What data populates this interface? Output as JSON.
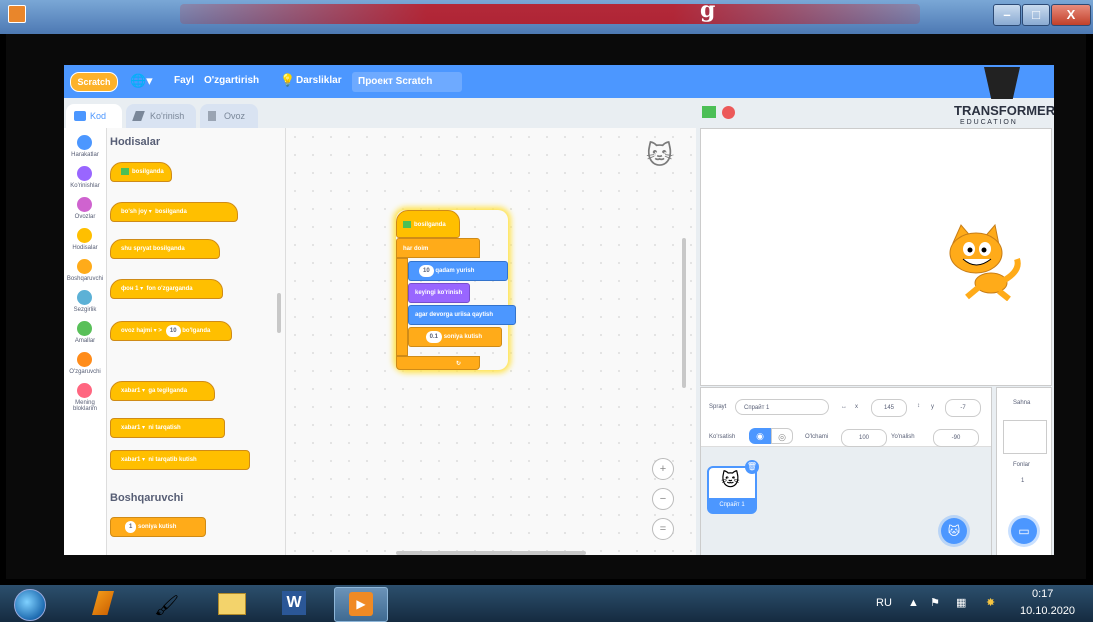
{
  "window": {
    "title_fragment": "g",
    "buttons": {
      "minimize": "–",
      "maximize": "□",
      "close": "X"
    }
  },
  "menubar": {
    "logo": "Scratch",
    "language_icon": "globe-icon",
    "file": "Fayl",
    "edit": "O'zgartirish",
    "tutorials": "Darsliklar",
    "project_title": "Проект Scratch"
  },
  "tabs": [
    {
      "label": "Kod",
      "active": true
    },
    {
      "label": "Ko'rinish",
      "active": false
    },
    {
      "label": "Ovoz",
      "active": false
    }
  ],
  "categories": [
    {
      "label": "Harakatlar",
      "color": "#4c97ff"
    },
    {
      "label": "Ko'rinishlar",
      "color": "#9966ff"
    },
    {
      "label": "Ovozlar",
      "color": "#cf63cf"
    },
    {
      "label": "Hodisalar",
      "color": "#ffbf00"
    },
    {
      "label": "Boshqaruvchi",
      "color": "#ffab19"
    },
    {
      "label": "Sezgirlik",
      "color": "#5cb1d6"
    },
    {
      "label": "Amallar",
      "color": "#59c059"
    },
    {
      "label": "O'zgaruvchi",
      "color": "#ff8c1a"
    },
    {
      "label": "Mening bloklarim",
      "color": "#ff6680"
    }
  ],
  "palette": {
    "section1": "Hodisalar",
    "section2": "Boshqaruvchi",
    "blocks": {
      "b1": "bosilganda",
      "b2_key": "bo'sh joy",
      "b2": "bosilganda",
      "b3": "shu spryat bosilganda",
      "b4_drop": "фон 1",
      "b4": "fon o'zgarganda",
      "b5_drop": "ovoz hajmi",
      "b5_val": "10",
      "b5": "bo'lganda",
      "b6_drop": "xabar1",
      "b6": "ga tegilganda",
      "b7_drop": "xabar1",
      "b7": "ni tarqatish",
      "b8_drop": "xabar1",
      "b8": "ni tarqatib kutish",
      "b9_val": "1",
      "b9": "soniya kutish"
    }
  },
  "script": {
    "hat": "bosilganda",
    "forever": "har doim",
    "move_val": "10",
    "move": "qadam yurish",
    "next_costume": "keyingi ko'rinish",
    "bounce": "agar devorga uriisa qaytish",
    "wait_val": "0.1",
    "wait": "soniya kutish"
  },
  "zoom": {
    "in": "+",
    "out": "−",
    "reset": "="
  },
  "watermark": {
    "brand": "TRANSFORMERS",
    "sub": "E D U C A T I O N"
  },
  "sprite_info": {
    "sprite_label": "Sprayt",
    "sprite_name": "Спрайт 1",
    "x_label": "x",
    "x": "145",
    "y_label": "y",
    "y": "-7",
    "show_label": "Ko'rsatish",
    "size_label": "O'lchami",
    "size": "100",
    "direction_label": "Yo'nalish",
    "direction": "-90",
    "thumb_label": "Спрайт 1"
  },
  "stage_panel": {
    "title": "Sahna",
    "backdrops_label": "Fonlar",
    "backdrops_count": "1"
  },
  "taskbar": {
    "lang": "RU",
    "time": "0:17",
    "date": "10.10.2020"
  },
  "colors": {
    "scratch_blue": "#4c97ff",
    "events": "#ffbf00",
    "control": "#ffab19"
  }
}
